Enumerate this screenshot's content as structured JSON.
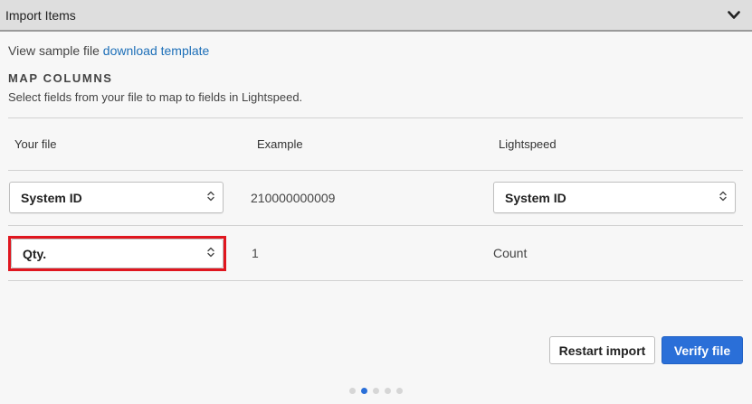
{
  "header": {
    "title": "Import Items",
    "collapse_icon": "chevron-down-icon"
  },
  "sample": {
    "prefix": "View sample file",
    "link_text": "download template"
  },
  "map": {
    "title": "MAP COLUMNS",
    "description": "Select fields from your file to map to fields in Lightspeed."
  },
  "columns": {
    "your_file": "Your file",
    "example": "Example",
    "lightspeed": "Lightspeed"
  },
  "rows": [
    {
      "your_file": "System ID",
      "example": "210000000009",
      "lightspeed": "System ID"
    },
    {
      "your_file": "Qty.",
      "example": "1",
      "lightspeed": "Count"
    }
  ],
  "buttons": {
    "restart": "Restart import",
    "verify": "Verify file"
  },
  "pagination": {
    "total": 5,
    "current": 2
  },
  "colors": {
    "accent": "#2a6fd8",
    "highlight": "#e0161f",
    "link": "#1d6fb8"
  }
}
